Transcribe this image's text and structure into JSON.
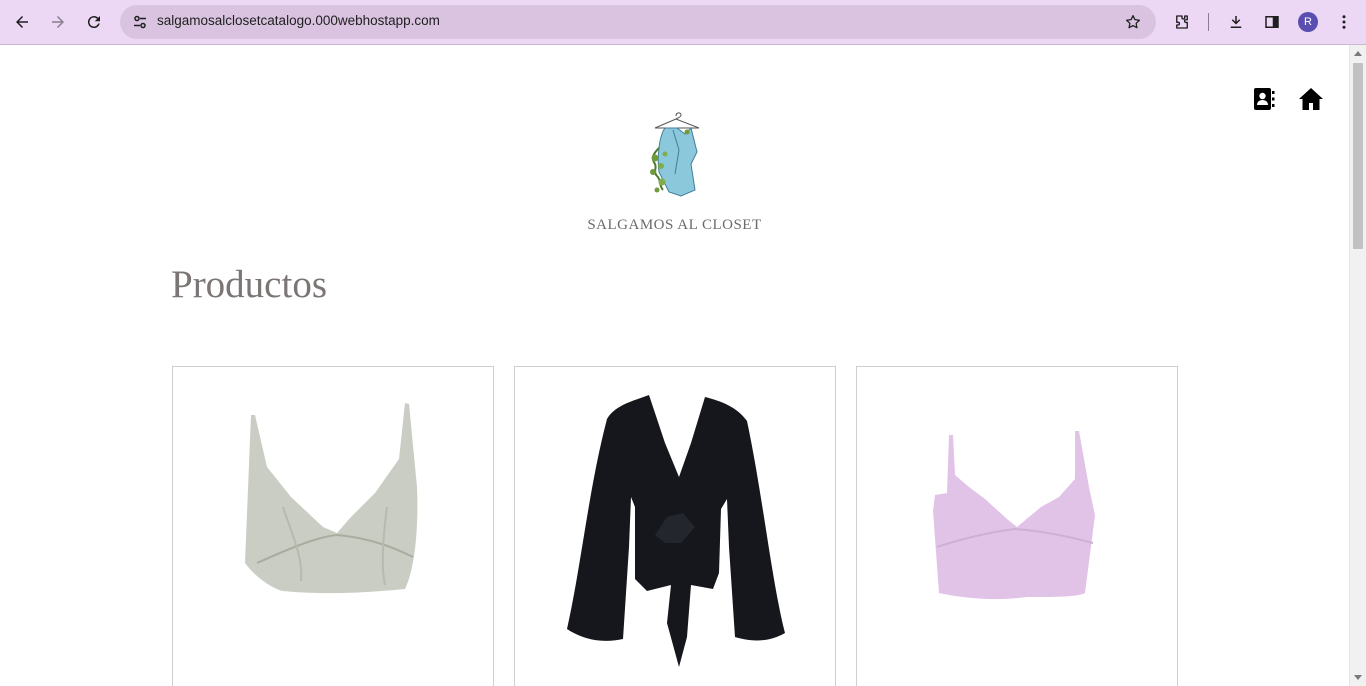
{
  "browser": {
    "url": "salgamosalclosetcatalogo.000webhostapp.com",
    "profile_initial": "R",
    "icons": [
      "back-arrow-icon",
      "forward-arrow-icon",
      "reload-icon",
      "site-info-icon",
      "star-icon",
      "extensions-icon",
      "download-icon",
      "side-panel-icon",
      "kebab-menu-icon"
    ]
  },
  "header": {
    "brand": "SALGAMOS AL CLOSET",
    "icons": [
      "contact-book-icon",
      "home-icon"
    ],
    "logo": "hanging-jacket-logo"
  },
  "main": {
    "heading": "Productos",
    "products": [
      {
        "image": "sage-satin-bralette-top",
        "color": "#c9cdc3"
      },
      {
        "image": "black-tie-front-bell-sleeve-top",
        "color": "#15171c"
      },
      {
        "image": "lilac-bralette-top",
        "color": "#e2c3e8"
      }
    ]
  },
  "colors": {
    "chrome": "#ecd7f4",
    "omnibox": "#d9c3e0",
    "heading_text": "#7b7675"
  }
}
